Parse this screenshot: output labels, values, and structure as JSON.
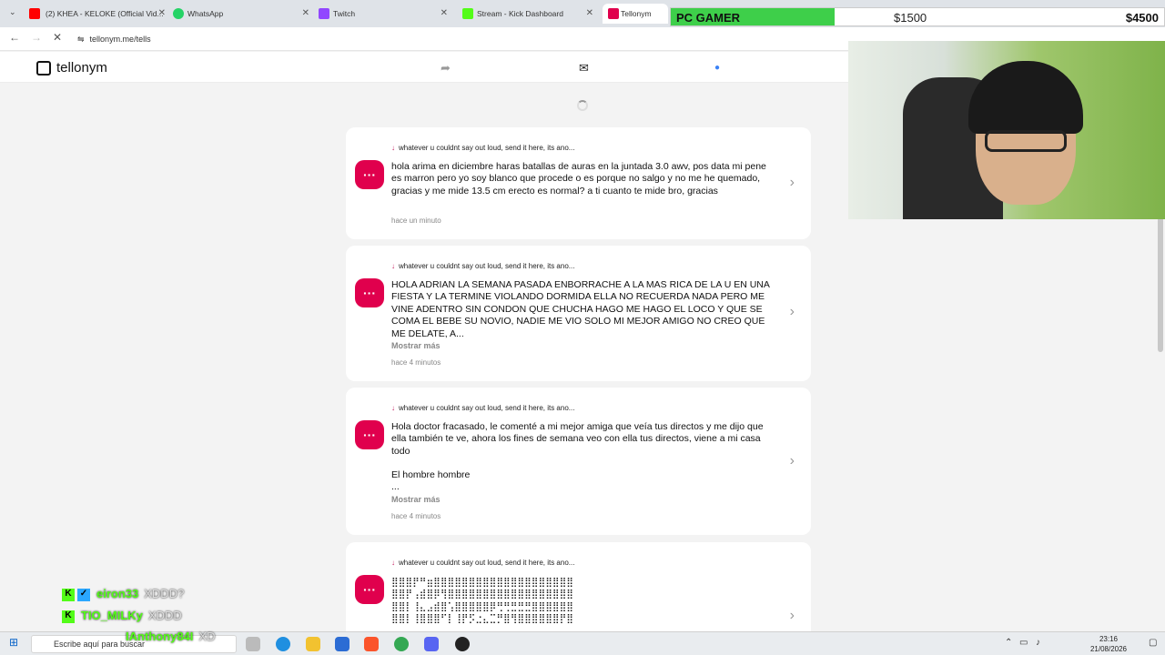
{
  "browser": {
    "tabs": [
      {
        "label": "(2) KHEA - KELOKE (Official Vid...",
        "color": "#ff0000"
      },
      {
        "label": "WhatsApp",
        "color": "#25d366"
      },
      {
        "label": "Twitch",
        "color": "#9146ff"
      },
      {
        "label": "Stream - Kick Dashboard",
        "color": "#53fc18"
      },
      {
        "label": "Tellonym",
        "color": "#e0004d"
      }
    ],
    "url": "tellonym.me/tells"
  },
  "site": {
    "logo": "tellonym"
  },
  "tells": [
    {
      "prompt": "whatever u couldnt say out loud, send it here, its ano...",
      "message": "hola arima en diciembre haras batallas de auras en la juntada 3.0 awv, pos data mi pene es marron pero yo soy blanco que procede o es porque no salgo y no me he quemado, gracias y me mide 13.5 cm erecto es normal? a ti cuanto te mide bro, gracias",
      "more": "",
      "time": "hace un minuto"
    },
    {
      "prompt": "whatever u couldnt say out loud, send it here, its ano...",
      "message": "HOLA ADRIAN LA SEMANA PASADA ENBORRACHE A LA MAS RICA DE LA U EN UNA FIESTA Y LA TERMINE VIOLANDO DORMIDA ELLA NO RECUERDA NADA PERO ME VINE ADENTRO SIN CONDON QUE CHUCHA HAGO ME HAGO EL LOCO Y QUE SE COMA EL BEBE SU NOVIO, NADIE ME VIO SOLO MI MEJOR AMIGO NO CREO QUE ME DELATE, A...",
      "more": "Mostrar más",
      "time": "hace 4 minutos"
    },
    {
      "prompt": "whatever u couldnt say out loud, send it here, its ano...",
      "message": "Hola doctor fracasado, le comenté a mi mejor amiga que veía tus directos y me dijo que ella también te ve, ahora los fines de semana veo con ella tus directos, viene a mi casa todo",
      "message2": "El hombre hombre",
      "ellipsis": "...",
      "more": "Mostrar más",
      "time": "hace 4 minutos"
    },
    {
      "prompt": "whatever u couldnt say out loud, send it here, its ano...",
      "ascii": [
        "⣿⣿⣿⡟⠛⣶⣿⣿⣿⣿⣿⣿⣿⣿⣿⣿⣿⣿⣿⣿⣿⣿⣿⣿⣿⣿",
        "⣿⣿⡟⢠⣾⣿⡿⢻⣿⣿⣿⣿⣿⣿⣿⣿⣿⣿⣿⣿⣿⣿⣿⣿⣿⣿",
        "⣿⣿⡇⢸⣄⣠⣾⣿⢡⣿⣿⣿⣿⣿⡿⢛⢛⣛⣛⣛⣿⣿⣿⣿⣿⣿",
        "⣿⣿⡇⢸⣿⣿⣿⠋⡇⢸⡟⡫⣐⣄⣉⡛⣿⢻⣿⣿⣿⣿⣿⣿⡟⣿"
      ]
    }
  ],
  "overlay": {
    "goal_title": "PC GAMER",
    "goal_current": "$1500",
    "goal_target": "$4500",
    "goal_progress": 0.333
  },
  "chat": [
    {
      "user": "eiron33",
      "text": "XDDD?"
    },
    {
      "user": "TIO_MILKy",
      "text": "XDDD"
    },
    {
      "user": "IAnthony84I",
      "text": "XD"
    }
  ],
  "taskbar": {
    "search_placeholder": "Escribe aquí para buscar",
    "time": "23:16",
    "date": "21/08/2026"
  },
  "colors": {
    "accent": "#e0004d",
    "kick_green": "#53fc18"
  }
}
